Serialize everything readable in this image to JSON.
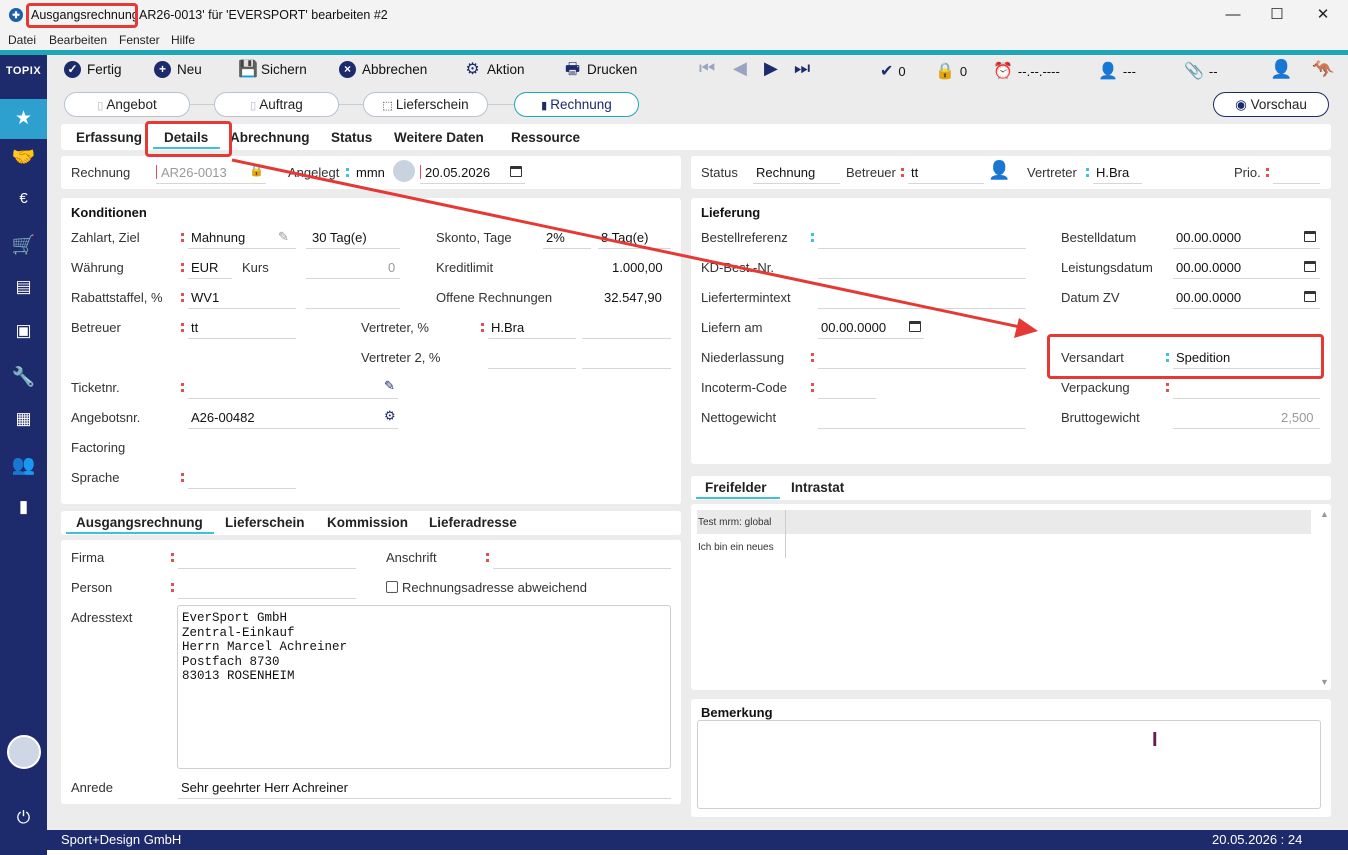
{
  "window": {
    "title_prefix": "Ausgangsrechnung",
    "title_rest": "AR26-0013' für 'EVERSPORT' bearbeiten #2",
    "minimize": "—",
    "maximize": "☐",
    "close": "✕"
  },
  "menu": [
    "Datei",
    "Bearbeiten",
    "Fenster",
    "Hilfe"
  ],
  "sidebar": {
    "logo": "TOPIX"
  },
  "toolbar": {
    "fertig": "Fertig",
    "neu": "Neu",
    "sichern": "Sichern",
    "abbrechen": "Abbrechen",
    "aktion": "Aktion",
    "drucken": "Drucken",
    "check_count": "0",
    "lock_count": "0",
    "date_placeholder": "--.--.----",
    "user_placeholder": "---",
    "clip_placeholder": "--"
  },
  "workflow": {
    "angebot": "Angebot",
    "auftrag": "Auftrag",
    "lieferschein": "Lieferschein",
    "rechnung": "Rechnung",
    "vorschau": "Vorschau"
  },
  "tabs": [
    "Erfassung",
    "Details",
    "Abrechnung",
    "Status",
    "Weitere Daten",
    "Ressource"
  ],
  "header_left": {
    "rechnung_label": "Rechnung",
    "rechnung_value": "AR26-0013",
    "angelegt_label": "Angelegt",
    "angelegt_user": "mmn",
    "angelegt_date": "20.05.2026"
  },
  "header_right": {
    "status_label": "Status",
    "status_value": "Rechnung",
    "betreuer_label": "Betreuer",
    "betreuer_value": "tt",
    "vertreter_label": "Vertreter",
    "vertreter_value": "H.Bra",
    "prio_label": "Prio."
  },
  "konditionen": {
    "title": "Konditionen",
    "zahlart_label": "Zahlart, Ziel",
    "zahlart_value": "Mahnung",
    "ziel_value": "30 Tag(e)",
    "skonto_label": "Skonto, Tage",
    "skonto_pct": "2%",
    "skonto_tage": "8 Tag(e)",
    "waehrung_label": "Währung",
    "waehrung_value": "EUR",
    "kurs_label": "Kurs",
    "kurs_value": "0",
    "kreditlimit_label": "Kreditlimit",
    "kreditlimit_value": "1.000,00",
    "rabatt_label": "Rabattstaffel, %",
    "rabatt_value": "WV1",
    "offene_label": "Offene Rechnungen",
    "offene_value": "32.547,90",
    "betreuer_label": "Betreuer",
    "betreuer_value": "tt",
    "vertreter_label": "Vertreter, %",
    "vertreter_value": "H.Bra",
    "vertreter2_label": "Vertreter 2, %",
    "ticket_label": "Ticketnr.",
    "angebot_label": "Angebotsnr.",
    "angebot_value": "A26-00482",
    "factoring_label": "Factoring",
    "sprache_label": "Sprache"
  },
  "lieferung": {
    "title": "Lieferung",
    "bestellref_label": "Bestellreferenz",
    "kdbest_label": "KD-Best.-Nr.",
    "liefertermintext_label": "Liefertermintext",
    "liefern_am_label": "Liefern am",
    "liefern_am_value": "00.00.0000",
    "niederlassung_label": "Niederlassung",
    "incoterm_label": "Incoterm-Code",
    "netto_label": "Nettogewicht",
    "bestelldatum_label": "Bestelldatum",
    "bestelldatum_value": "00.00.0000",
    "leistungsdatum_label": "Leistungsdatum",
    "leistungsdatum_value": "00.00.0000",
    "datumzv_label": "Datum ZV",
    "datumzv_value": "00.00.0000",
    "versandart_label": "Versandart",
    "versandart_value": "Spedition",
    "verpackung_label": "Verpackung",
    "brutto_label": "Bruttogewicht",
    "brutto_value": "2,500"
  },
  "address_tabs": [
    "Ausgangsrechnung",
    "Lieferschein",
    "Kommission",
    "Lieferadresse"
  ],
  "address": {
    "firma_label": "Firma",
    "person_label": "Person",
    "anschrift_label": "Anschrift",
    "abweichend_label": "Rechnungsadresse abweichend",
    "adresstext_label": "Adresstext",
    "adresstext": "EverSport GmbH\nZentral-Einkauf\nHerrn Marcel Achreiner\nPostfach 8730\n83013 ROSENHEIM",
    "anrede_label": "Anrede",
    "anrede_value": "Sehr geehrter Herr Achreiner"
  },
  "freifelder_tabs": [
    "Freifelder",
    "Intrastat"
  ],
  "freifelder_rows": [
    "Test mrm: global",
    "Ich bin ein neues"
  ],
  "bemerkung": {
    "title": "Bemerkung"
  },
  "statusbar": {
    "company": "Sport+Design GmbH",
    "datetime": "20.05.2026 : 24"
  },
  "colors": {
    "navy": "#1d2a6b",
    "teal": "#1fa6b6",
    "highlight": "#e53935"
  }
}
